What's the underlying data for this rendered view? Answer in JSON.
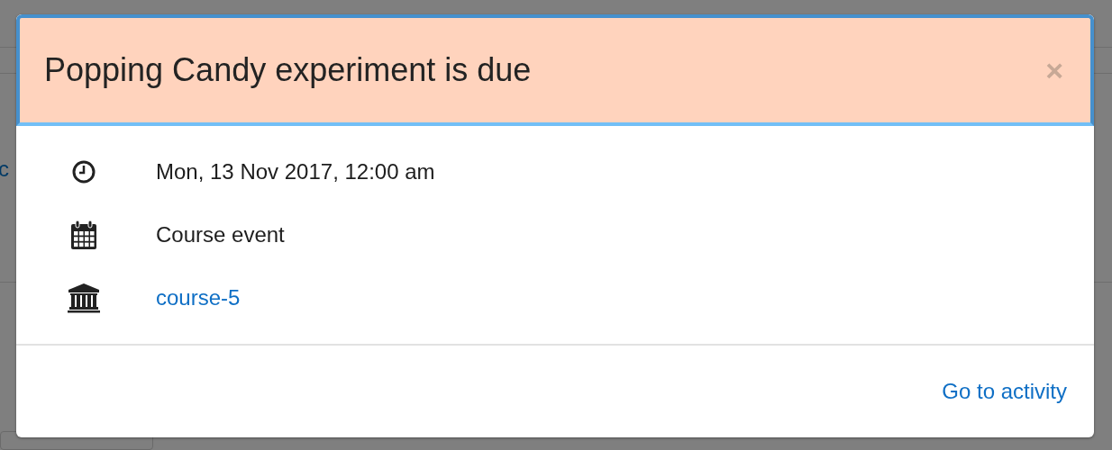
{
  "background": {
    "link_text": "c"
  },
  "modal": {
    "title": "Popping Candy experiment is due",
    "close": "×",
    "details": [
      {
        "kind": "time",
        "text": "Mon, 13 Nov 2017, 12:00 am",
        "link": false
      },
      {
        "kind": "event_type",
        "text": "Course event",
        "link": false
      },
      {
        "kind": "course",
        "text": "course-5",
        "link": true
      }
    ],
    "action": "Go to activity"
  }
}
